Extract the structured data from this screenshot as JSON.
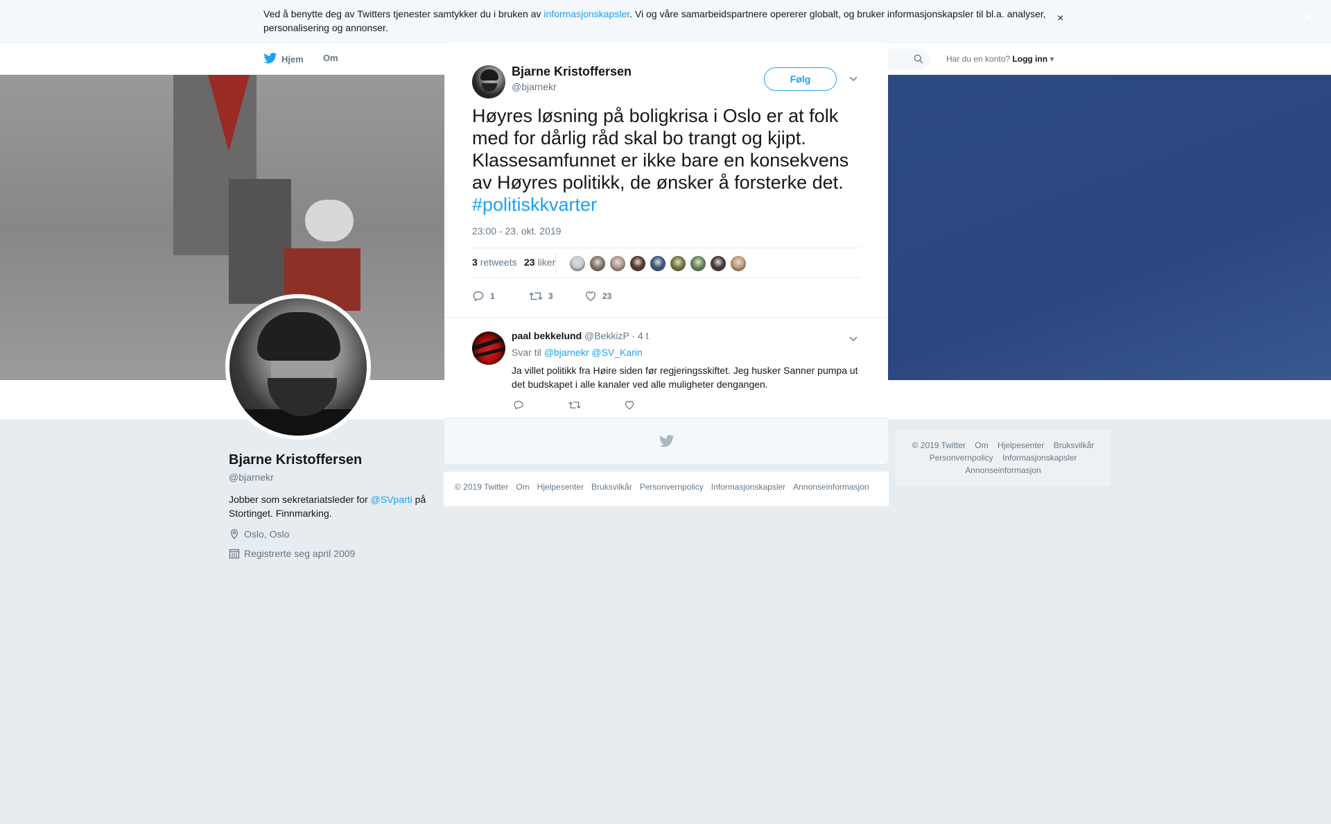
{
  "cookie": {
    "text_before": "Ved å benytte deg av Twitters tjenester samtykker du i bruken av ",
    "link": "informasjonskapsler",
    "text_after": ". Vi og våre samarbeidspartnere opererer globalt, og bruker informasjonskapsler til bl.a. analyser, personalisering og annonser.",
    "close": "×"
  },
  "nav": {
    "home": "Hjem",
    "about": "Om",
    "account_prompt": "Har du en konto?",
    "login": "Logg inn"
  },
  "profile": {
    "name": "Bjarne Kristoffersen",
    "handle": "@bjarnekr",
    "bio_before": "Jobber som sekretariatsleder for ",
    "bio_link": "@SVparti",
    "bio_after": " på Stortinget. Finnmarking.",
    "location": "Oslo, Oslo",
    "joined": "Registrerte seg april 2009"
  },
  "side_footer": {
    "links": [
      "© 2019 Twitter",
      "Om",
      "Hjelpesenter",
      "Bruksvilkår",
      "Personvernpolicy",
      "Informasjonskapsler",
      "Annonseinformasjon"
    ]
  },
  "overlay": {
    "close": "×"
  },
  "tweet": {
    "author_name": "Bjarne Kristoffersen",
    "author_handle": "@bjarnekr",
    "follow_label": "Følg",
    "text": "Høyres løsning på boligkrisa i Oslo er at folk med for dårlig råd skal bo trangt og kjipt. Klassesamfunnet er ikke bare en konsekvens av Høyres politikk, de ønsker å forsterke det. ",
    "hashtag": "#politiskkvarter",
    "timestamp": "23:00 - 23. okt. 2019",
    "retweets_count": "3",
    "retweets_label": "retweets",
    "likes_count": "23",
    "likes_label": "liker",
    "reply_count": "1",
    "retweet_action_count": "3",
    "like_action_count": "23",
    "liker_colors": [
      "#c8ced3",
      "#8a7a6a",
      "#b59a8e",
      "#5a3b2a",
      "#3d5a80",
      "#7a7a3a",
      "#6a8a5a",
      "#4a3a3a",
      "#c89a7a"
    ]
  },
  "reply": {
    "name": "paal bekkelund",
    "handle": "@BekkizP",
    "time": "· 4 t",
    "replying_prefix": "Svar til",
    "mention1": "@bjarnekr",
    "mention2": "@SV_Karin",
    "text": "Ja villet politikk fra Høire siden før regjeringsskiftet. Jeg husker Sanner pumpa ut det budskapet i alle kanaler ved alle muligheter dengangen."
  },
  "modal_footer": {
    "links": [
      "© 2019 Twitter",
      "Om",
      "Hjelpesenter",
      "Bruksvilkår",
      "Personvernpolicy",
      "Informasjonskapsler",
      "Annonseinformasjon"
    ]
  }
}
